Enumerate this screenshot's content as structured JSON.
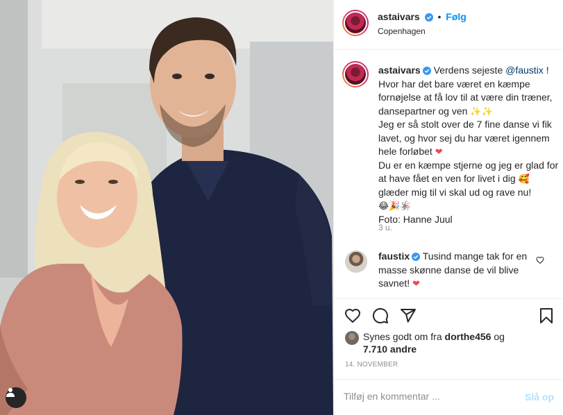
{
  "post": {
    "username": "astaivars",
    "follow_label": "Følg",
    "separator": "•",
    "location": "Copenhagen"
  },
  "caption": {
    "username": "astaivars",
    "intro": "Verdens sejeste ",
    "mention": "@faustix",
    "line_1": " ! Hvor har det bare været en kæmpe fornøjelse at få lov til at være din træner, dansepartner og ven ",
    "emoji_1": "✨✨",
    "line_2": "Jeg er så stolt over de 7 fine danse vi fik lavet, og hvor sej du har været igennem hele forløbet ",
    "emoji_2": "❤",
    "line_3": "Du er en kæmpe stjerne og jeg er glad for at have fået en ven for livet i dig ",
    "emoji_3": "🥰",
    "line_4": " glæder mig til vi skal ud og rave nu! ",
    "emoji_4": "😂🎉🪅",
    "photo_credit": "Foto: Hanne Juul",
    "time_ago": "3 u."
  },
  "comment": {
    "username": "faustix",
    "text": " Tusind mange tak for en masse skønne danse de vil blive savnet! ",
    "emoji": "❤"
  },
  "likes": {
    "prefix": "Synes godt om fra ",
    "user": "dorthe456",
    "mid": " og",
    "count_text": "7.710 andre"
  },
  "date": "14. NOVEMBER",
  "comment_box": {
    "placeholder": "Tilføj en kommentar ...",
    "post_label": "Slå op"
  },
  "colors": {
    "accent": "#0095f6",
    "verified": "#3897f0",
    "like_red": "#ed4956"
  },
  "icons": [
    "user-tag-icon",
    "verified-icon",
    "heart-icon",
    "comment-icon",
    "share-icon",
    "bookmark-icon"
  ]
}
